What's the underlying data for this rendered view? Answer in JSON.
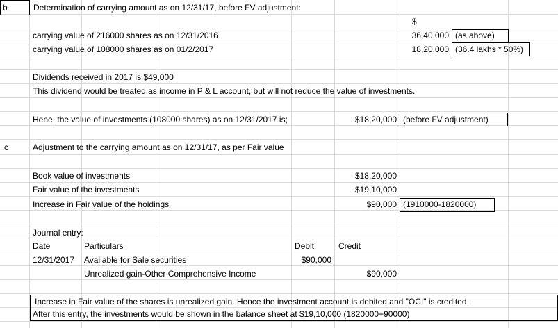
{
  "sections": {
    "b": {
      "letter": "b",
      "heading": "Determination of carrying amount as on 12/31/17, before FV adjustment:",
      "currency_header": "$",
      "rows": [
        {
          "label": "carrying value of 216000 shares as on 12/31/2016",
          "amount": "36,40,000",
          "note": "(as above)"
        },
        {
          "label": "carrying value of 108000 shares as on 01/2/2017",
          "amount": "18,20,000",
          "note": "(36.4 lakhs * 50%)"
        }
      ],
      "dividends_line": "Dividends received in 2017 is $49,000",
      "dividend_note": "This dividend would be treated as income in P & L account, but will not reduce the value of investments.",
      "summary_label": "Hene, the value of investments (108000 shares) as on 12/31/2017 is;",
      "summary_amount": "$18,20,000",
      "summary_note": "(before FV adjustment)"
    },
    "c": {
      "letter": "c",
      "heading": "Adjustment to the carrying amount as on 12/31/17, as per Fair value",
      "rows": [
        {
          "label": "Book value of investments",
          "amount": "$18,20,000",
          "note": ""
        },
        {
          "label": "Fair value of the investments",
          "amount": "$19,10,000",
          "note": ""
        },
        {
          "label": "Increase in Fair value of the holdings",
          "amount": "$90,000",
          "note": "(1910000-1820000)"
        }
      ],
      "journal": {
        "title": "Journal entry:",
        "headers": {
          "date": "Date",
          "particulars": "Particulars",
          "debit": "Debit",
          "credit": "Credit"
        },
        "entries": [
          {
            "date": "12/31/2017",
            "particulars": "Available for Sale securities",
            "debit": "$90,000",
            "credit": ""
          },
          {
            "date": "",
            "particulars": "Unrealized gain-Other Comprehensive Income",
            "debit": "",
            "credit": "$90,000"
          }
        ]
      },
      "conclusion": [
        "Increase in Fair value of the shares is unrealized gain. Hence the investment account is debited and \"OCI\" is credited.",
        "After this entry, the investments would be shown in the balance sheet at $19,10,000 (1820000+90000)"
      ]
    }
  }
}
